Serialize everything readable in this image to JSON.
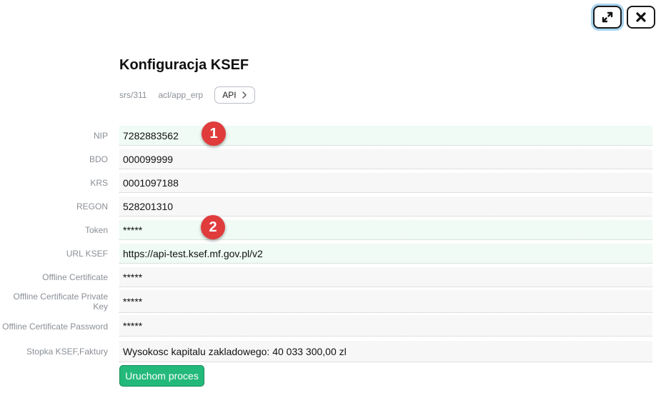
{
  "header": {
    "expand_icon": "expand-arrows-icon",
    "close_icon": "close-x-icon"
  },
  "page": {
    "title": "Konfiguracja KSEF"
  },
  "breadcrumbs": {
    "items": [
      "srs/311",
      "acl/app_erp"
    ],
    "api_label": "API",
    "api_icon": "chevron-right-icon"
  },
  "fields": {
    "nip": {
      "label": "NIP",
      "value": "7282883562"
    },
    "bdo": {
      "label": "BDO",
      "value": "000099999"
    },
    "krs": {
      "label": "KRS",
      "value": "0001097188"
    },
    "regon": {
      "label": "REGON",
      "value": "528201310"
    },
    "token": {
      "label": "Token",
      "value": "*****"
    },
    "url_ksef": {
      "label": "URL KSEF",
      "value": "https://api-test.ksef.mf.gov.pl/v2"
    },
    "offline_cert": {
      "label": "Offline Certificate",
      "value": "*****"
    },
    "offline_key": {
      "label": "Offline Certificate Private Key",
      "value": "*****"
    },
    "offline_pass": {
      "label": "Offline Certificate Password",
      "value": "*****"
    },
    "stopka": {
      "label": "Stopka KSEF,Faktury",
      "value": "Wysokosc kapitalu zakladowego: 40 033 300,00 zl"
    }
  },
  "annotations": {
    "marker_1": "1",
    "marker_2": "2"
  },
  "actions": {
    "run_label": "Uruchom proces"
  },
  "colors": {
    "highlight_row": "#effbf4",
    "normal_row": "#f7f7f7",
    "run_button": "#23b97a",
    "marker": "#e03c3c",
    "focus_ring": "#a8d4f0"
  }
}
